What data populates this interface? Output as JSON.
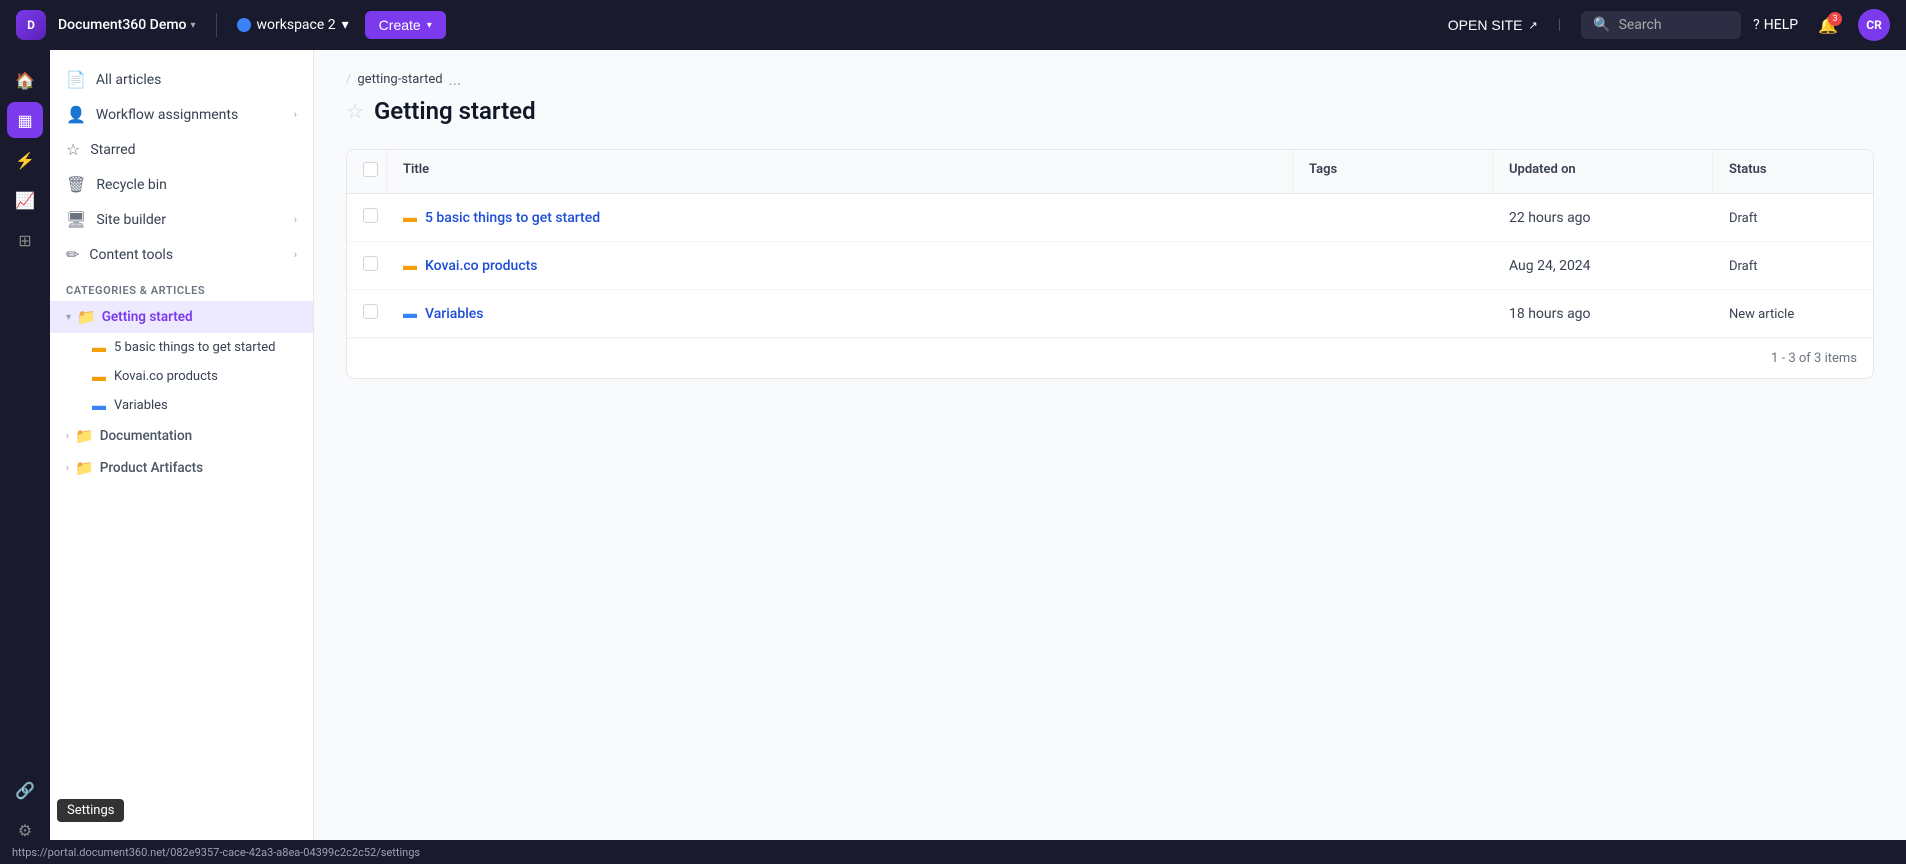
{
  "header": {
    "logo_text": "D",
    "app_name": "Document360 Demo",
    "workspace": "workspace 2",
    "create_label": "Create",
    "open_site_label": "OPEN SITE",
    "search_placeholder": "Search",
    "help_label": "HELP",
    "notification_count": "3",
    "avatar_initials": "CR"
  },
  "rail": {
    "items": [
      {
        "name": "home-icon",
        "icon": "⊞",
        "active": false
      },
      {
        "name": "grid-icon",
        "icon": "▦",
        "active": true
      },
      {
        "name": "settings-cog-icon",
        "icon": "⚙",
        "active": false
      },
      {
        "name": "analytics-icon",
        "icon": "📊",
        "active": false
      },
      {
        "name": "widgets-icon",
        "icon": "⊡",
        "active": false
      }
    ],
    "bottom_items": [
      {
        "name": "integrations-icon",
        "icon": "⊞"
      },
      {
        "name": "settings-icon",
        "icon": "⚙"
      }
    ],
    "settings_tooltip": "Settings"
  },
  "sidebar": {
    "all_articles_label": "All articles",
    "workflow_label": "Workflow assignments",
    "starred_label": "Starred",
    "recycle_bin_label": "Recycle bin",
    "site_builder_label": "Site builder",
    "content_tools_label": "Content tools",
    "categories_header": "CATEGORIES & ARTICLES",
    "tree": {
      "getting_started": {
        "label": "Getting started",
        "children": [
          {
            "label": "5 basic things to get started",
            "icon_color": "yellow"
          },
          {
            "label": "Kovai.co products",
            "icon_color": "yellow"
          },
          {
            "label": "Variables",
            "icon_color": "blue"
          }
        ]
      },
      "documentation": {
        "label": "Documentation"
      },
      "product_artifacts": {
        "label": "Product Artifacts"
      }
    }
  },
  "breadcrumb": {
    "separator": "/",
    "current": "getting-started",
    "more": "..."
  },
  "page": {
    "title": "Getting started",
    "pagination": "1 - 3 of 3 items"
  },
  "table": {
    "columns": [
      "",
      "Title",
      "Tags",
      "Updated on",
      "Status"
    ],
    "rows": [
      {
        "title": "5 basic things to get started",
        "icon_color": "yellow",
        "tags": "",
        "updated_on": "22 hours ago",
        "status": "Draft"
      },
      {
        "title": "Kovai.co products",
        "icon_color": "yellow",
        "tags": "",
        "updated_on": "Aug 24, 2024",
        "status": "Draft"
      },
      {
        "title": "Variables",
        "icon_color": "blue",
        "tags": "",
        "updated_on": "18 hours ago",
        "status": "New article"
      }
    ]
  },
  "status_bar": {
    "url": "https://portal.document360.net/082e9357-cace-42a3-a8ea-04399c2c2c52/settings"
  }
}
